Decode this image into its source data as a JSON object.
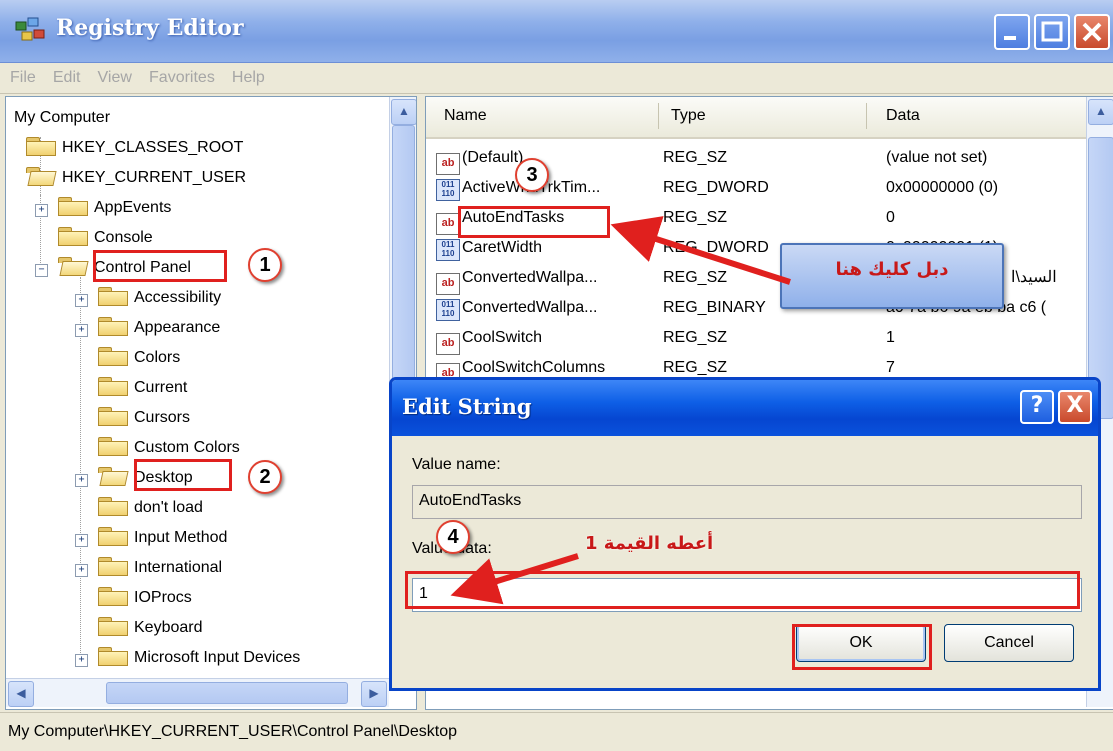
{
  "window": {
    "title": "Registry Editor"
  },
  "menu": [
    "File",
    "Edit",
    "View",
    "Favorites",
    "Help"
  ],
  "tree": {
    "root": "My Computer",
    "hives": [
      "HKEY_CLASSES_ROOT",
      "HKEY_CURRENT_USER"
    ],
    "hkcu_children": [
      "AppEvents",
      "Console",
      "Control Panel"
    ],
    "control_panel_children": [
      "Accessibility",
      "Appearance",
      "Colors",
      "Current",
      "Cursors",
      "Custom Colors",
      "Desktop",
      "don't load",
      "Input Method",
      "International",
      "IOProcs",
      "Keyboard",
      "Microsoft Input Devices"
    ]
  },
  "list": {
    "columns": {
      "name": "Name",
      "type": "Type",
      "data": "Data"
    },
    "rows": [
      {
        "name": "(Default)",
        "type": "REG_SZ",
        "data": "(value not set)",
        "icon": "string-value-icon"
      },
      {
        "name": "ActiveWndTrkTim...",
        "type": "REG_DWORD",
        "data": "0x00000000 (0)",
        "icon": "binary-value-icon"
      },
      {
        "name": "AutoEndTasks",
        "type": "REG_SZ",
        "data": "0",
        "icon": "string-value-icon"
      },
      {
        "name": "CaretWidth",
        "type": "REG_DWORD",
        "data": "0x00000001 (1)",
        "icon": "binary-value-icon"
      },
      {
        "name": "ConvertedWallpa...",
        "type": "REG_SZ",
        "data": "السيد\\ا",
        "icon": "string-value-icon"
      },
      {
        "name": "ConvertedWallpa...",
        "type": "REG_BINARY",
        "data": "a0 7a b6 9a eb ba c6 (",
        "icon": "binary-value-icon"
      },
      {
        "name": "CoolSwitch",
        "type": "REG_SZ",
        "data": "1",
        "icon": "string-value-icon"
      },
      {
        "name": "CoolSwitchColumns",
        "type": "REG_SZ",
        "data": "7",
        "icon": "string-value-icon"
      }
    ]
  },
  "status": {
    "path": "My Computer\\HKEY_CURRENT_USER\\Control Panel\\Desktop"
  },
  "dialog": {
    "title": "Edit String",
    "value_name_label": "Value name:",
    "value_name": "AutoEndTasks",
    "value_data_label": "Value data:",
    "value_data": "1",
    "ok_label": "OK",
    "cancel_label": "Cancel",
    "help_symbol": "?",
    "close_symbol": "X"
  },
  "annotations": {
    "badges": [
      "1",
      "2",
      "3",
      "4"
    ],
    "callout_text": "دبل كليك هنا",
    "value_note": "أعطه القيمة 1",
    "accent_color": "#e0201e"
  }
}
